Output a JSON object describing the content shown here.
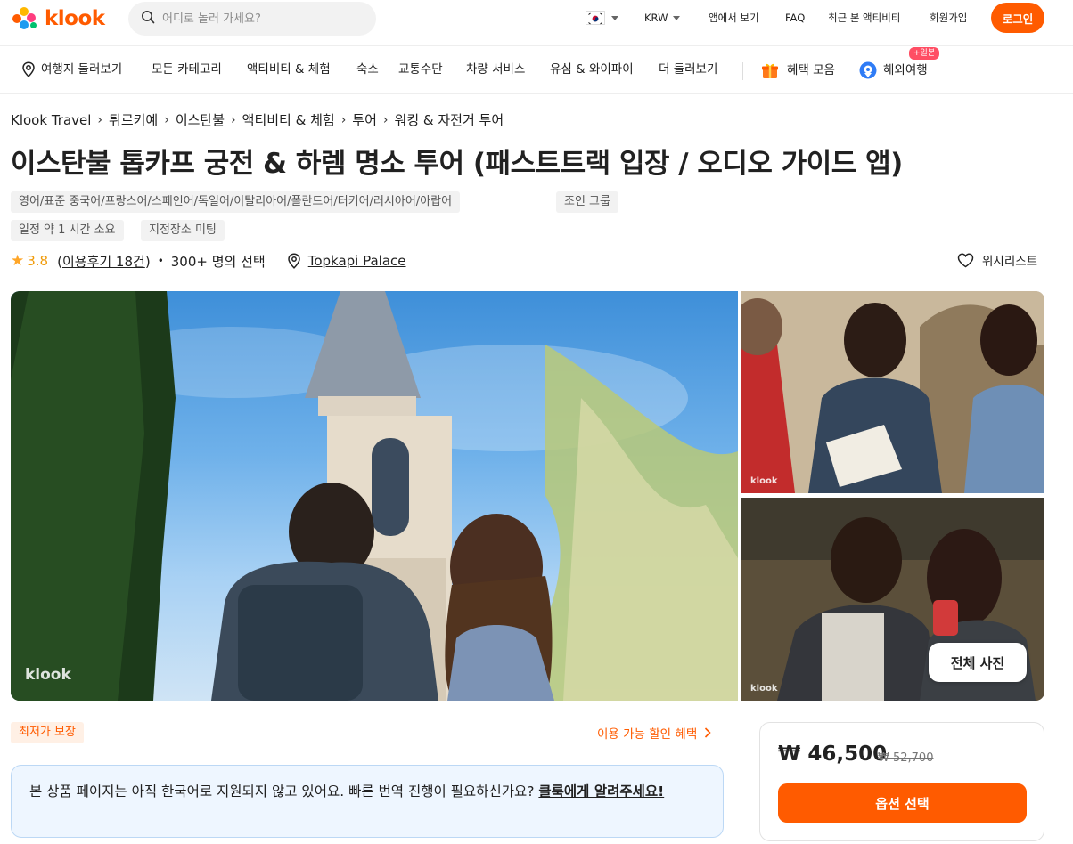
{
  "header": {
    "logo_text": "klook",
    "search_placeholder": "어디로 놀러 가세요?",
    "currency": "KRW",
    "app_label": "앱에서 보기",
    "faq_label": "FAQ",
    "recent_label": "최근 본 액티비티",
    "signup_label": "회원가입",
    "login_label": "로그인",
    "brand_color": "#ff5b00"
  },
  "nav": {
    "items": [
      {
        "label": "여행지 둘러보기",
        "icon": "map-pin-icon"
      },
      {
        "label": "모든 카테고리"
      },
      {
        "label": "액티비티 & 체험"
      },
      {
        "label": "숙소"
      },
      {
        "label": "교통수단"
      },
      {
        "label": "차량 서비스"
      },
      {
        "label": "유심 & 와이파이"
      },
      {
        "label": "더 둘러보기"
      }
    ],
    "benefits_label": "혜택 모음",
    "overseas_label": "해외여행",
    "overseas_badge": "+일본"
  },
  "breadcrumb": [
    "Klook Travel",
    "튀르키예",
    "이스탄불",
    "액티비티 & 체험",
    "투어",
    "워킹 & 자전거 투어"
  ],
  "product": {
    "title": "이스탄불 톱카프 궁전 & 하렘 명소 투어 (패스트트랙 입장 / 오디오 가이드 앱)",
    "language_tag": "영어/표준 중국어/프랑스어/스페인어/독일어/이탈리아어/폴란드어/터키어/러시아어/아랍어",
    "group_tag": "조인 그룹",
    "duration_tag": "일정 약 1 시간 소요",
    "meeting_tag": "지정장소 미팅",
    "rating": "3.8",
    "reviews_open": "(",
    "reviews_label": "이용후기 18건",
    "reviews_close": ")",
    "booked": "300+ 명의 선택",
    "location": "Topkapi Palace",
    "wishlist_label": "위시리스트"
  },
  "gallery": {
    "watermark": "klook",
    "all_photos_label": "전체 사진"
  },
  "bottom": {
    "best_price_label": "최저가 보장",
    "discount_label": "이용 가능 할인 혜택",
    "notice_text": "본 상품 페이지는 아직 한국어로 지원되지 않고 있어요. 빠른 번역 진행이 필요하신가요? ",
    "notice_link": "클룩에게 알려주세요!",
    "price": "₩ 46,500",
    "old_price": "₩ 52,700",
    "select_label": "옵션 선택"
  }
}
